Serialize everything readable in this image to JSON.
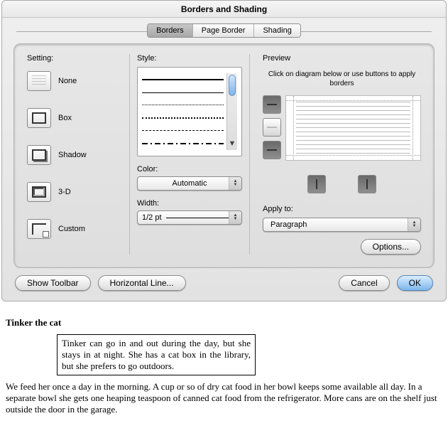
{
  "dialog": {
    "title": "Borders and Shading",
    "tabs": [
      "Borders",
      "Page Border",
      "Shading"
    ],
    "active_tab": 0,
    "setting_label": "Setting:",
    "settings": [
      "None",
      "Box",
      "Shadow",
      "3-D",
      "Custom"
    ],
    "style_label": "Style:",
    "color_label": "Color:",
    "color_value": "Automatic",
    "width_label": "Width:",
    "width_value": "1/2 pt",
    "preview_label": "Preview",
    "preview_hint": "Click on diagram below or use buttons to apply borders",
    "apply_to_label": "Apply to:",
    "apply_to_value": "Paragraph",
    "buttons": {
      "options": "Options...",
      "show_toolbar": "Show Toolbar",
      "horizontal_line": "Horizontal Line...",
      "cancel": "Cancel",
      "ok": "OK"
    }
  },
  "document": {
    "title": "Tinker the cat",
    "boxed_paragraph": "Tinker can go in and out during the day, but she stays in at night. She has a cat box in the library, but she prefers to go outdoors.",
    "body_paragraph": "We feed her once a day in the morning. A cup or so of dry cat food in her bowl keeps some available all day. In a separate bowl she gets one heaping teaspoon of canned cat food from the refrigerator. More cans are on the shelf just outside the door in the garage."
  }
}
